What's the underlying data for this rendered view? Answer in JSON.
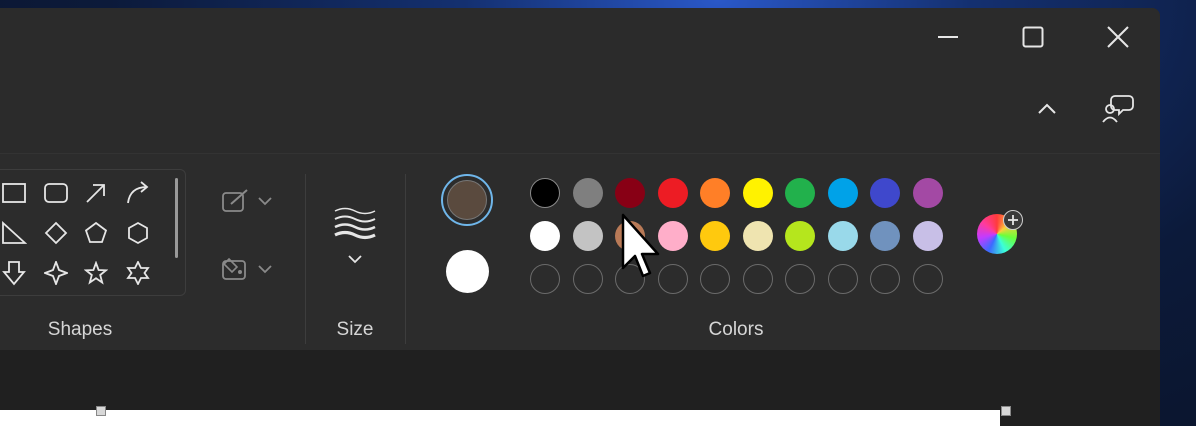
{
  "window_controls": {
    "minimize_icon": "minimize-icon",
    "maximize_icon": "maximize-icon",
    "close_icon": "close-icon"
  },
  "toolbar_right": {
    "collapse_icon": "chevron-up-icon",
    "feedback_icon": "feedback-icon"
  },
  "ribbon": {
    "shapes": {
      "label": "Shapes",
      "items": [
        "rectangle",
        "rounded-rectangle",
        "arrow",
        "curved-arrow",
        "right-triangle",
        "diamond",
        "pentagon",
        "hexagon",
        "down-arrow",
        "four-point-star",
        "five-point-star",
        "six-point-star"
      ]
    },
    "outline_label": "outline",
    "fill_label": "fill",
    "size": {
      "label": "Size"
    },
    "colors": {
      "label": "Colors",
      "primary": "#5a4a3e",
      "secondary": "#ffffff",
      "row1": [
        "#000000",
        "#7f7f7f",
        "#880015",
        "#ed1c24",
        "#ff7f27",
        "#fff200",
        "#22b14c",
        "#00a2e8",
        "#3f48cc",
        "#a349a4"
      ],
      "row2": [
        "#ffffff",
        "#c3c3c3",
        "#b97a57",
        "#ffaec9",
        "#ffc90e",
        "#efe4b0",
        "#b5e61d",
        "#99d9ea",
        "#7092be",
        "#c8bfe7"
      ],
      "row3_count": 10,
      "edit_colors_icon": "color-wheel-plus-icon"
    }
  },
  "colors_accent": {
    "selection_ring": "#6fb6ea",
    "background": "#2b2b2b"
  }
}
